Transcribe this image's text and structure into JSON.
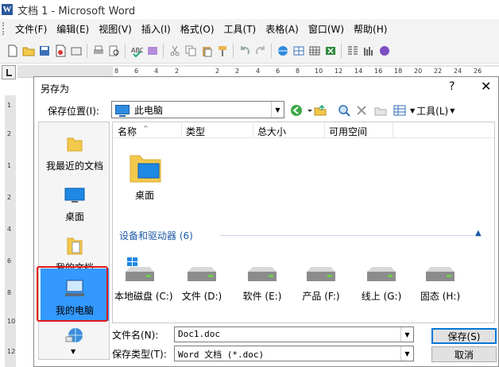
{
  "app": {
    "title": "文档 1 - Microsoft Word",
    "logo": "W"
  },
  "menu": [
    "文件(F)",
    "编辑(E)",
    "视图(V)",
    "插入(I)",
    "格式(O)",
    "工具(T)",
    "表格(A)",
    "窗口(W)",
    "帮助(H)"
  ],
  "ruler": {
    "numbers": [
      "8",
      "6",
      "4",
      "2",
      "2",
      "2",
      "4",
      "6",
      "8",
      "10",
      "12",
      "14",
      "16",
      "18",
      "20",
      "22",
      "24",
      "26"
    ],
    "v_numbers": [
      "1",
      "2",
      "1",
      "2",
      "4",
      "6",
      "8",
      "10",
      "12"
    ]
  },
  "dialog": {
    "title": "另存为",
    "help": "?",
    "close": "✕",
    "location_label": "保存位置(I):",
    "location_value": "此电脑",
    "tools_label": "工具(L)",
    "places": [
      {
        "label": "我最近的文档",
        "icon": "folder-icon"
      },
      {
        "label": "桌面",
        "icon": "desktop-icon"
      },
      {
        "label": "我的文档",
        "icon": "documents-folder-icon"
      },
      {
        "label": "我的电脑",
        "icon": "computer-icon"
      },
      {
        "label": "",
        "icon": "network-globe-icon"
      }
    ],
    "columns": [
      "名称",
      "类型",
      "总大小",
      "可用空间"
    ],
    "desktop_item": "桌面",
    "group_title": "设备和驱动器 (6)",
    "drives": [
      "本地磁盘 (C:)",
      "文件 (D:)",
      "软件 (E:)",
      "产品 (F:)",
      "线上 (G:)",
      "固态 (H:)"
    ],
    "filename_label": "文件名(N):",
    "filename_value": "Doc1.doc",
    "filetype_label": "保存类型(T):",
    "filetype_value": "Word 文档 (*.doc)",
    "save_label": "保存(S)",
    "cancel_label": "取消"
  }
}
